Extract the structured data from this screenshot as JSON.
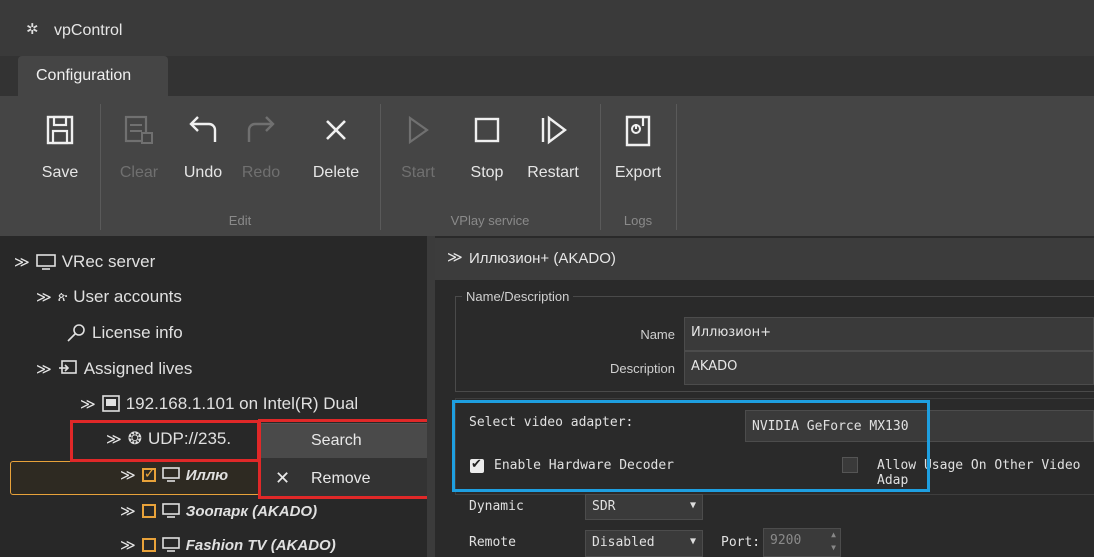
{
  "window": {
    "title": "vpControl"
  },
  "tabs": {
    "configuration": "Configuration"
  },
  "toolbar": {
    "save": "Save",
    "clear": "Clear",
    "undo": "Undo",
    "redo": "Redo",
    "delete": "Delete",
    "start": "Start",
    "stop": "Stop",
    "restart": "Restart",
    "export": "Export",
    "groups": {
      "edit": "Edit",
      "vplay": "VPlay service",
      "logs": "Logs"
    }
  },
  "tree": {
    "root": "VRec server",
    "user_accounts": "User accounts",
    "license_info": "License info",
    "assigned_lives": "Assigned lives",
    "host": "192.168.1.101 on Intel(R) Dual",
    "udp": "UDP://235.",
    "ch1": "Иллю",
    "ch2": "Зоопарк (AKADO)",
    "ch3": "Fashion TV (AKADO)"
  },
  "context_menu": {
    "search": "Search",
    "remove": "Remove"
  },
  "panel": {
    "header": "Иллюзион+ (AKADO)",
    "group_title": "Name/Description",
    "name_label": "Name",
    "name_value": "Иллюзион+",
    "description_label": "Description",
    "description_value": "AKADO",
    "adapter_label": "Select video adapter:",
    "adapter_value": "NVIDIA GeForce MX130",
    "hw_decoder_label": "Enable Hardware Decoder",
    "hw_decoder_checked": true,
    "allow_other_label": "Allow Usage On Other Video Adap",
    "allow_other_checked": false,
    "dynamic_label": "Dynamic",
    "dynamic_value": "SDR",
    "remote_label": "Remote",
    "remote_value": "Disabled",
    "port_label": "Port:",
    "port_value": "9200"
  },
  "colors": {
    "highlight_red": "#e02828",
    "highlight_blue": "#1e9fe0",
    "checkbox_orange": "#e8a23a"
  }
}
